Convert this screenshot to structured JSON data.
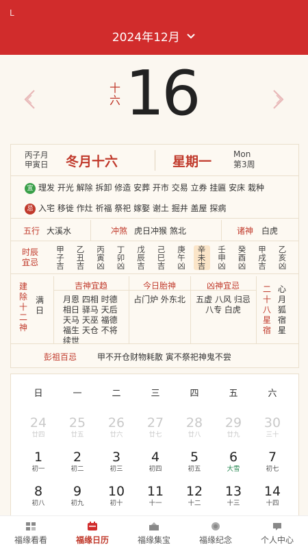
{
  "header": {
    "back_glyph": "L",
    "month_label": "2024年12月",
    "dropdown_glyph": "⌄"
  },
  "big_date": {
    "day": "16",
    "lunar_vertical": "十六"
  },
  "day_info": {
    "ganzhi_month": "丙子月",
    "ganzhi_day": "甲寅日",
    "lunar": "冬月十六",
    "weekday": "星期一",
    "weekday_en": "Mon",
    "week_no": "第3周",
    "yi_badge": "宜",
    "yi": "理发 开光 解除 拆卸 修造 安葬 开市 交易 立券 挂匾 安床 栽种",
    "ji_badge": "忌",
    "ji": "入宅 移徙 作灶 祈福 祭祀 嫁娶 谢土 掘井 盖屋 探病",
    "wuxing_label": "五行",
    "wuxing": "大溪水",
    "chongsha_label": "冲煞",
    "chongsha": "虎日冲猴 煞北",
    "zhushen_label": "诸神",
    "zhushen": "白虎",
    "shichen_label1": "时辰",
    "shichen_label2": "宜忌",
    "shichen": [
      {
        "gz1": "甲",
        "gz2": "子",
        "r": "吉"
      },
      {
        "gz1": "乙",
        "gz2": "丑",
        "r": "吉"
      },
      {
        "gz1": "丙",
        "gz2": "寅",
        "r": "凶"
      },
      {
        "gz1": "丁",
        "gz2": "卯",
        "r": "凶"
      },
      {
        "gz1": "戊",
        "gz2": "辰",
        "r": "吉"
      },
      {
        "gz1": "己",
        "gz2": "巳",
        "r": "吉"
      },
      {
        "gz1": "庚",
        "gz2": "午",
        "r": "凶"
      },
      {
        "gz1": "辛",
        "gz2": "未",
        "r": "吉"
      },
      {
        "gz1": "壬",
        "gz2": "申",
        "r": "凶"
      },
      {
        "gz1": "癸",
        "gz2": "酉",
        "r": "凶"
      },
      {
        "gz1": "甲",
        "gz2": "戌",
        "r": "吉"
      },
      {
        "gz1": "乙",
        "gz2": "亥",
        "r": "凶"
      }
    ],
    "jianchu_label": "建除十二神",
    "jianchu": "满日",
    "jishen_head": "吉神宜趋",
    "jishen": "月恩 四相 时德 相日 驿马 天后 天马 天巫 福德 福生 天仓 不将 续世",
    "taishen_head": "今日胎神",
    "taishen": "占门炉 外东北",
    "xiongshen_head": "凶神宜忌",
    "xiongshen": "五虚 八风 归忌 八专 白虎",
    "xiu_label": "二十八星宿",
    "xiu": "心月狐宿星",
    "pengzu_label": "彭祖百忌",
    "pengzu": "甲不开仓财物耗散 寅不祭祀神鬼不尝"
  },
  "calendar": {
    "weekdays": [
      "日",
      "一",
      "二",
      "三",
      "四",
      "五",
      "六"
    ],
    "rows": [
      [
        {
          "n": "24",
          "s": "廿四",
          "prev": true
        },
        {
          "n": "25",
          "s": "廿五",
          "prev": true
        },
        {
          "n": "26",
          "s": "廿六",
          "prev": true
        },
        {
          "n": "27",
          "s": "廿七",
          "prev": true
        },
        {
          "n": "28",
          "s": "廿八",
          "prev": true
        },
        {
          "n": "29",
          "s": "廿九",
          "prev": true
        },
        {
          "n": "30",
          "s": "三十",
          "prev": true
        }
      ],
      [
        {
          "n": "1",
          "s": "初一"
        },
        {
          "n": "2",
          "s": "初二"
        },
        {
          "n": "3",
          "s": "初三"
        },
        {
          "n": "4",
          "s": "初四"
        },
        {
          "n": "5",
          "s": "初五"
        },
        {
          "n": "6",
          "s": "大雪",
          "term": true
        },
        {
          "n": "7",
          "s": "初七"
        }
      ],
      [
        {
          "n": "8",
          "s": "初八"
        },
        {
          "n": "9",
          "s": "初九"
        },
        {
          "n": "10",
          "s": "初十"
        },
        {
          "n": "11",
          "s": "十一"
        },
        {
          "n": "12",
          "s": "十二"
        },
        {
          "n": "13",
          "s": "十三"
        },
        {
          "n": "14",
          "s": "十四"
        }
      ]
    ]
  },
  "tabs": [
    {
      "label": "福缘看看",
      "icon": "grid-icon",
      "active": false
    },
    {
      "label": "福缘日历",
      "icon": "calendar-icon",
      "active": true
    },
    {
      "label": "福缘集宝",
      "icon": "treasure-icon",
      "active": false
    },
    {
      "label": "福缘纪念",
      "icon": "memorial-icon",
      "active": false
    },
    {
      "label": "个人中心",
      "icon": "profile-icon",
      "active": false
    }
  ],
  "colors": {
    "brand_red": "#d12c2c",
    "accent_red": "#c0392b",
    "term_green": "#2e8b57"
  }
}
